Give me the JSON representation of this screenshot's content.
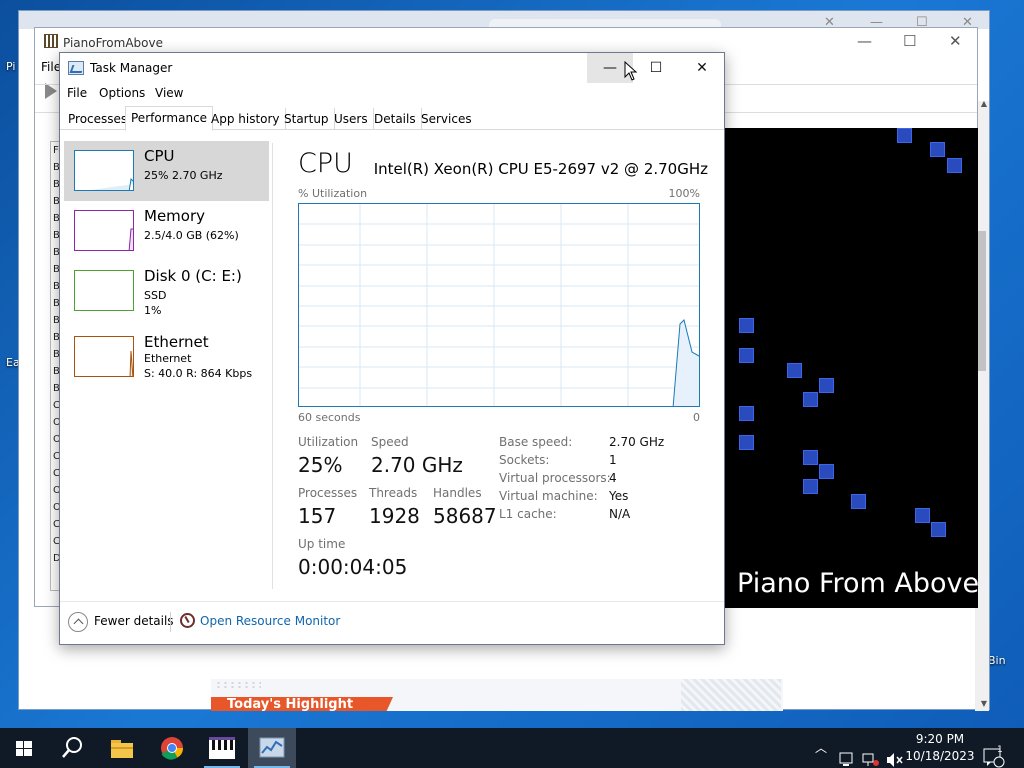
{
  "desktop": {
    "fragments": [
      "Pi",
      "Ea",
      "Bin"
    ]
  },
  "browser": {
    "banner_text": "Today's Highlight"
  },
  "pfa": {
    "title": "PianoFromAbove",
    "menu_file": "File",
    "viz_title": "Piano From Above",
    "playlist_letters": [
      "Fi",
      "B",
      "B",
      "B",
      "B",
      "B",
      "B",
      "B",
      "B",
      "B",
      "B",
      "B",
      "B",
      "B",
      "B",
      "C",
      "O",
      "O",
      "C",
      "C",
      "O",
      "O",
      "C",
      "C",
      "D"
    ]
  },
  "taskmanager": {
    "title": "Task Manager",
    "menu": [
      "File",
      "Options",
      "View"
    ],
    "tabs": [
      "Processes",
      "Performance",
      "App history",
      "Startup",
      "Users",
      "Details",
      "Services"
    ],
    "active_tab": "Performance",
    "sidebar": [
      {
        "name": "CPU",
        "sub1": "25%  2.70 GHz",
        "sub2": "",
        "color": "#1a7ab8"
      },
      {
        "name": "Memory",
        "sub1": "2.5/4.0 GB (62%)",
        "sub2": "",
        "color": "#8b26a6"
      },
      {
        "name": "Disk 0 (C: E:)",
        "sub1": "SSD",
        "sub2": "1%",
        "color": "#4ca231"
      },
      {
        "name": "Ethernet",
        "sub1": "Ethernet",
        "sub2": "S: 40.0  R: 864 Kbps",
        "color": "#a7520f"
      }
    ],
    "main": {
      "title": "CPU",
      "cpu_name": "Intel(R) Xeon(R) CPU E5-2697 v2 @ 2.70GHz",
      "graph_label": "% Utilization",
      "graph_max": "100%",
      "graph_time": "60 seconds",
      "graph_min": "0",
      "utilization_label": "Utilization",
      "utilization": "25%",
      "speed_label": "Speed",
      "speed": "2.70 GHz",
      "processes_label": "Processes",
      "processes": "157",
      "threads_label": "Threads",
      "threads": "1928",
      "handles_label": "Handles",
      "handles": "58687",
      "uptime_label": "Up time",
      "uptime": "0:00:04:05",
      "details": [
        {
          "k": "Base speed:",
          "v": "2.70 GHz"
        },
        {
          "k": "Sockets:",
          "v": "1"
        },
        {
          "k": "Virtual processors:",
          "v": "4"
        },
        {
          "k": "Virtual machine:",
          "v": "Yes"
        },
        {
          "k": "L1 cache:",
          "v": "N/A"
        }
      ]
    },
    "footer": {
      "fewer_details": "Fewer details",
      "open_resource_monitor": "Open Resource Monitor"
    }
  },
  "taskbar": {
    "time": "9:20 PM",
    "date": "10/18/2023",
    "notification_count": "1"
  }
}
